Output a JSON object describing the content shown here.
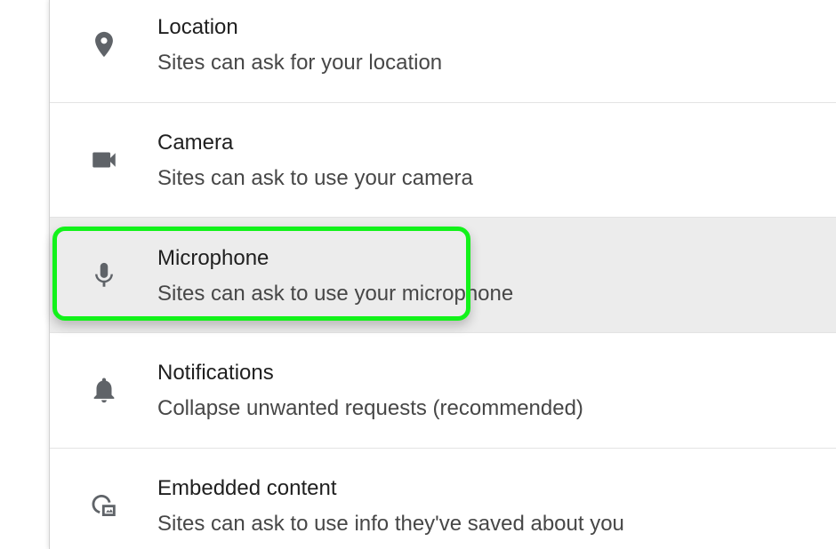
{
  "settings_list": {
    "items": [
      {
        "icon": "location-pin-icon",
        "title": "Location",
        "subtitle": "Sites can ask for your location"
      },
      {
        "icon": "camera-icon",
        "title": "Camera",
        "subtitle": "Sites can ask to use your camera"
      },
      {
        "icon": "microphone-icon",
        "title": "Microphone",
        "subtitle": "Sites can ask to use your microphone"
      },
      {
        "icon": "bell-icon",
        "title": "Notifications",
        "subtitle": "Collapse unwanted requests (recommended)"
      },
      {
        "icon": "embedded-content-icon",
        "title": "Embedded content",
        "subtitle": "Sites can ask to use info they've saved about you"
      }
    ]
  },
  "highlight_color": "#12f21a",
  "hover_row_color": "#ececec",
  "icon_color": "#5f6368"
}
